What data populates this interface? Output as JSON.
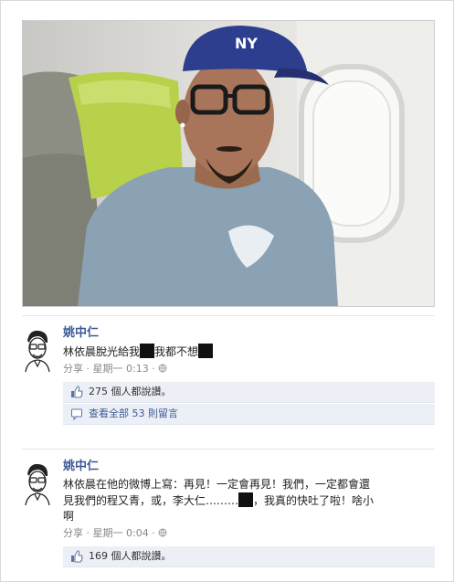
{
  "posts": [
    {
      "author": "姚中仁",
      "text_parts": [
        "林依晨脫光給我",
        "我都不想"
      ],
      "meta": {
        "share": "分享",
        "sep": "·",
        "day": "星期一",
        "time": "0:13"
      },
      "likes": "275 個人都說讚。",
      "comments_link": "查看全部 53 則留言"
    },
    {
      "author": "姚中仁",
      "text_line1": "林依晨在他的微博上寫：再見！一定會再見！我們，一定都會還",
      "text_line2_parts": [
        "見我們的程又青，或，李大仁………",
        "，我真的快吐了啦！啥小"
      ],
      "text_line3": "啊",
      "meta": {
        "share": "分享",
        "sep": "·",
        "day": "星期一",
        "time": "0:04"
      },
      "likes": "169 個人都說讚。"
    }
  ],
  "colors": {
    "link": "#3b5998",
    "shirt": "#8aa2b4",
    "seat_green": "#b7d14b",
    "cap": "#2e3e8f"
  }
}
